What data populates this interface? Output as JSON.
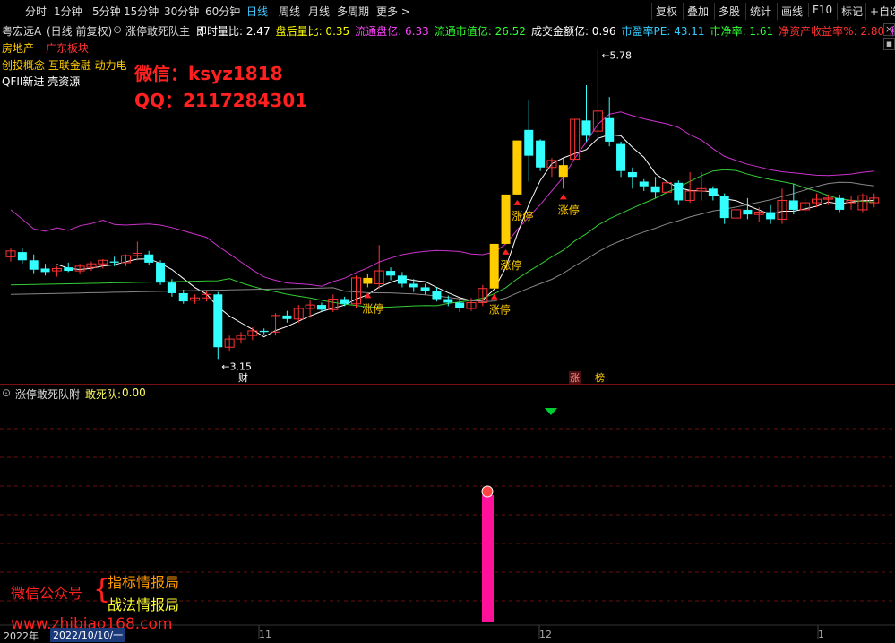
{
  "periods": [
    {
      "label": "分时",
      "active": false
    },
    {
      "label": "1分钟",
      "active": false
    },
    {
      "label": "5分钟",
      "active": false
    },
    {
      "label": "15分钟",
      "active": false
    },
    {
      "label": "30分钟",
      "active": false
    },
    {
      "label": "60分钟",
      "active": false
    },
    {
      "label": "日线",
      "active": true
    },
    {
      "label": "周线",
      "active": false
    },
    {
      "label": "月线",
      "active": false
    },
    {
      "label": "多周期",
      "active": false
    },
    {
      "label": "更多 >",
      "active": false
    }
  ],
  "tools": [
    "复权",
    "叠加",
    "多股",
    "统计",
    "画线",
    "F10",
    "标记",
    "+自选"
  ],
  "header": {
    "stock": "粤宏远A",
    "mode": "(日线 前复权)",
    "indicator": "涨停敢死队主",
    "items": [
      {
        "label": "即时量比:",
        "value": "2.47",
        "color": "#ffffff"
      },
      {
        "label": "盘后量比:",
        "value": "0.35",
        "color": "#ffff00"
      },
      {
        "label": "流通盘亿:",
        "value": "6.33",
        "color": "#ff44ff"
      },
      {
        "label": "流通市值亿:",
        "value": "26.52",
        "color": "#33ff33"
      },
      {
        "label": "成交金额亿:",
        "value": "0.96",
        "color": "#ffffff"
      },
      {
        "label": "市盈率PE:",
        "value": "43.11",
        "color": "#33ccff"
      },
      {
        "label": "市净率:",
        "value": "1.61",
        "color": "#33ff33"
      },
      {
        "label": "净资产收益率%:",
        "value": "2.80",
        "color": "#ff3333"
      },
      {
        "label": "利",
        "value": "",
        "color": "#ff44ff"
      }
    ]
  },
  "concepts": [
    {
      "text": "房地产",
      "color": "#ffcc00"
    },
    {
      "text": "广东板块",
      "color": "#ff3333"
    },
    {
      "text": "创投概念 互联金融 动力电",
      "color": "#ffcc00"
    },
    {
      "text": "QFII新进 壳资源",
      "color": "#ffffff"
    }
  ],
  "watermark": {
    "wechat": "微信：ksyz1818",
    "qq": "QQ：2117284301",
    "gzh": "微信公众号",
    "brace": "{",
    "line1": "指标情报局",
    "line2": "战法情报局",
    "site": "www.zhibiao168.com"
  },
  "sub_panel": {
    "title": "涨停敢死队附",
    "series": "敢死队:",
    "value": "0.00"
  },
  "price_labels": {
    "high": "5.78",
    "low": "3.15"
  },
  "markers": {
    "cai": "财",
    "zhang": "涨",
    "bang": "榜",
    "limit_up": "涨停"
  },
  "axis": {
    "year": "2022年",
    "date": "2022/10/10/一",
    "m11": "11",
    "m12": "12",
    "m1": "1"
  },
  "chart_data": {
    "type": "candlestick",
    "candles": [
      [
        4.02,
        4.09,
        3.98,
        4.07
      ],
      [
        4.06,
        4.1,
        3.96,
        3.99
      ],
      [
        3.99,
        4.04,
        3.88,
        3.91
      ],
      [
        3.92,
        3.96,
        3.86,
        3.89
      ],
      [
        3.9,
        3.94,
        3.85,
        3.92
      ],
      [
        3.93,
        3.97,
        3.89,
        3.9
      ],
      [
        3.9,
        3.96,
        3.87,
        3.94
      ],
      [
        3.93,
        3.98,
        3.9,
        3.96
      ],
      [
        3.96,
        4.0,
        3.92,
        3.99
      ],
      [
        3.98,
        4.02,
        3.94,
        3.97
      ],
      [
        3.97,
        4.04,
        3.94,
        4.03
      ],
      [
        4.03,
        4.15,
        3.99,
        4.05
      ],
      [
        4.04,
        4.07,
        3.95,
        3.97
      ],
      [
        3.97,
        3.99,
        3.78,
        3.8
      ],
      [
        3.8,
        3.83,
        3.68,
        3.71
      ],
      [
        3.71,
        3.74,
        3.62,
        3.64
      ],
      [
        3.65,
        3.7,
        3.62,
        3.67
      ],
      [
        3.67,
        3.73,
        3.64,
        3.7
      ],
      [
        3.7,
        3.72,
        3.15,
        3.25
      ],
      [
        3.25,
        3.35,
        3.22,
        3.32
      ],
      [
        3.32,
        3.38,
        3.28,
        3.35
      ],
      [
        3.35,
        3.42,
        3.31,
        3.39
      ],
      [
        3.39,
        3.41,
        3.36,
        3.38
      ],
      [
        3.38,
        3.54,
        3.35,
        3.52
      ],
      [
        3.52,
        3.56,
        3.46,
        3.49
      ],
      [
        3.49,
        3.61,
        3.46,
        3.58
      ],
      [
        3.58,
        3.65,
        3.5,
        3.61
      ],
      [
        3.61,
        3.63,
        3.55,
        3.57
      ],
      [
        3.57,
        3.7,
        3.55,
        3.66
      ],
      [
        3.66,
        3.68,
        3.6,
        3.62
      ],
      [
        3.62,
        3.86,
        3.58,
        3.84
      ],
      [
        3.84,
        3.87,
        3.76,
        3.79
      ],
      [
        3.79,
        4.12,
        3.75,
        3.9
      ],
      [
        3.9,
        3.93,
        3.82,
        3.86
      ],
      [
        3.86,
        3.89,
        3.76,
        3.79
      ],
      [
        3.79,
        3.83,
        3.72,
        3.76
      ],
      [
        3.76,
        3.79,
        3.7,
        3.73
      ],
      [
        3.73,
        3.76,
        3.64,
        3.66
      ],
      [
        3.66,
        3.69,
        3.6,
        3.63
      ],
      [
        3.63,
        3.66,
        3.55,
        3.58
      ],
      [
        3.58,
        3.67,
        3.56,
        3.63
      ],
      [
        3.63,
        3.78,
        3.6,
        3.75
      ],
      [
        3.75,
        4.13,
        3.75,
        4.13
      ],
      [
        4.13,
        4.55,
        4.13,
        4.55
      ],
      [
        4.55,
        5.01,
        4.55,
        5.01
      ],
      [
        5.1,
        5.35,
        4.66,
        4.88
      ],
      [
        5.01,
        5.02,
        4.75,
        4.78
      ],
      [
        4.78,
        4.86,
        4.7,
        4.84
      ],
      [
        4.7,
        4.86,
        4.6,
        4.8
      ],
      [
        4.85,
        5.19,
        4.85,
        5.19
      ],
      [
        5.18,
        5.48,
        5.0,
        5.05
      ],
      [
        5.09,
        5.78,
        4.98,
        5.26
      ],
      [
        5.2,
        5.38,
        4.96,
        5.0
      ],
      [
        4.98,
        5.0,
        4.7,
        4.75
      ],
      [
        4.74,
        4.78,
        4.6,
        4.7
      ],
      [
        4.66,
        4.68,
        4.58,
        4.62
      ],
      [
        4.62,
        4.7,
        4.52,
        4.57
      ],
      [
        4.57,
        4.66,
        4.52,
        4.65
      ],
      [
        4.65,
        4.67,
        4.46,
        4.5
      ],
      [
        4.5,
        4.74,
        4.48,
        4.58
      ],
      [
        4.58,
        4.74,
        4.5,
        4.6
      ],
      [
        4.6,
        4.62,
        4.5,
        4.54
      ],
      [
        4.54,
        4.56,
        4.3,
        4.35
      ],
      [
        4.35,
        4.45,
        4.28,
        4.42
      ],
      [
        4.42,
        4.52,
        4.34,
        4.38
      ],
      [
        4.38,
        4.44,
        4.32,
        4.4
      ],
      [
        4.4,
        4.46,
        4.3,
        4.34
      ],
      [
        4.34,
        4.6,
        4.3,
        4.5
      ],
      [
        4.5,
        4.64,
        4.38,
        4.42
      ],
      [
        4.42,
        4.52,
        4.38,
        4.48
      ],
      [
        4.48,
        4.56,
        4.44,
        4.51
      ],
      [
        4.51,
        4.55,
        4.46,
        4.52
      ],
      [
        4.52,
        4.55,
        4.4,
        4.42
      ],
      [
        4.48,
        4.54,
        4.42,
        4.5
      ],
      [
        4.42,
        4.56,
        4.4,
        4.54
      ],
      [
        4.48,
        4.56,
        4.44,
        4.52
      ]
    ],
    "limit_up_index": [
      31,
      42,
      43,
      44,
      48
    ]
  }
}
